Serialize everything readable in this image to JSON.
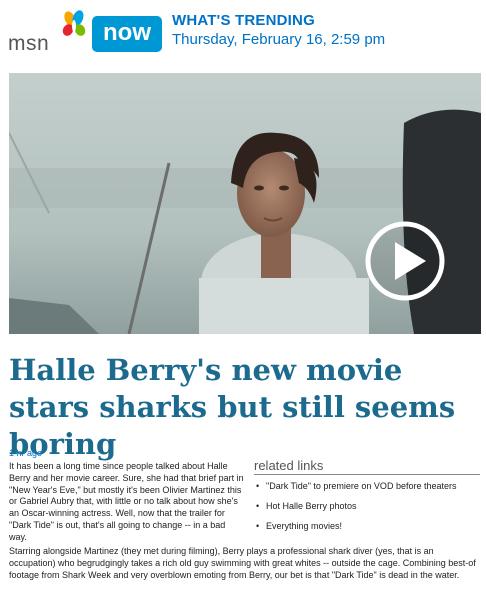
{
  "header": {
    "logo_text": "msn",
    "badge_text": "now",
    "section_title": "WHAT'S TRENDING",
    "date": "Thursday, February 16, 2:59 pm"
  },
  "colors": {
    "brand_blue": "#0098d4",
    "link_blue": "#0072c6",
    "headline_blue": "#1c6a8e"
  },
  "video": {
    "play_icon": "play-icon"
  },
  "article": {
    "headline": "Halle Berry's new movie stars sharks but still seems boring",
    "time_ago": "1 hr ago",
    "paragraph1": "It has been a long time since people talked about Halle Berry and her movie career. Sure, she had that brief part in \"New Year's Eve,\" but mostly it's been Olivier Martinez this or Gabriel Aubry that, with little or no talk about how she's an Oscar-winning actress. Well, now that the trailer for \"Dark Tide\" is out, that's all going to change -- in a bad way.",
    "paragraph2": "Starring alongside Martinez (they met during filming), Berry plays a professional shark diver (yes, that is an occupation) who begrudgingly takes a rich old guy swimming with great whites -- outside the cage. Combining best-of footage from Shark Week and very overblown emoting from Berry, our bet is that \"Dark Tide\" is dead in the water."
  },
  "related": {
    "title": "related links",
    "links": [
      "\"Dark Tide\" to premiere on VOD before theaters",
      "Hot Halle Berry photos",
      "Everything movies!"
    ]
  }
}
